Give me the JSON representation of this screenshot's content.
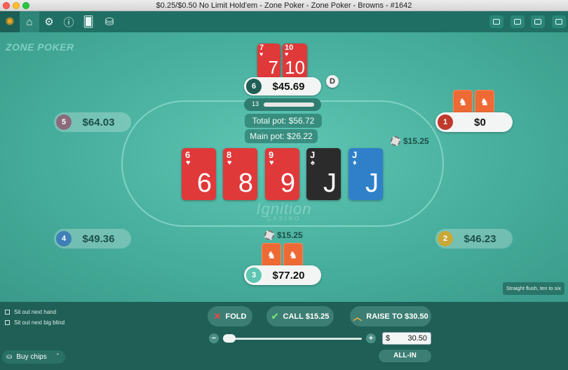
{
  "window": {
    "title": "$0.25/$0.50 No Limit Hold'em - Zone Poker - Zone Poker - Browns - #1642"
  },
  "toolbar": {
    "icons": [
      "ignition-logo-icon",
      "home-icon",
      "settings-icon",
      "info-icon",
      "cards-icon",
      "chip-icon"
    ],
    "right_icons": [
      "grid-icon",
      "tile-icon",
      "window-icon",
      "sidebar-icon"
    ]
  },
  "table": {
    "brand": "ZONE POKER",
    "watermark": "Ignition",
    "watermark_sub": "CASINO",
    "total_pot": "Total pot: $56.72",
    "main_pot": "Main pot: $26.22",
    "dealer_button": "D"
  },
  "seats": [
    {
      "seat": "1",
      "stack": "$0",
      "color": "#c0392b"
    },
    {
      "seat": "2",
      "stack": "$46.23",
      "color": "#c8a938"
    },
    {
      "seat": "3",
      "stack": "$77.20",
      "color": "#5ec6b2"
    },
    {
      "seat": "4",
      "stack": "$49.36",
      "color": "#3f7fb8"
    },
    {
      "seat": "5",
      "stack": "$64.03",
      "color": "#8b6b7b"
    },
    {
      "seat": "6",
      "stack": "$45.69",
      "color": "#1f5f56",
      "timer": "13"
    }
  ],
  "bets": {
    "seat1": "$15.25",
    "seat3": "$15.25"
  },
  "hero_cards": [
    {
      "rank": "7",
      "suit": "♥",
      "color": "red"
    },
    {
      "rank": "10",
      "suit": "♥",
      "color": "red"
    }
  ],
  "board": [
    {
      "rank": "6",
      "suit": "♥",
      "color": "red"
    },
    {
      "rank": "8",
      "suit": "♥",
      "color": "red"
    },
    {
      "rank": "9",
      "suit": "♥",
      "color": "red"
    },
    {
      "rank": "J",
      "suit": "♠",
      "color": "black"
    },
    {
      "rank": "J",
      "suit": "♦",
      "color": "blue"
    }
  ],
  "hint": "Straight flush, ten to six",
  "controls": {
    "sit_out_next_hand": "Sit out next hand",
    "sit_out_big_blind": "Sit out next big blind",
    "fold": "FOLD",
    "call": "CALL $15.25",
    "raise": "RAISE TO $30.50",
    "minus": "−",
    "plus": "+",
    "currency": "$",
    "raise_value": "30.50",
    "all_in": "ALL-IN",
    "buy_chips": "Buy chips"
  }
}
